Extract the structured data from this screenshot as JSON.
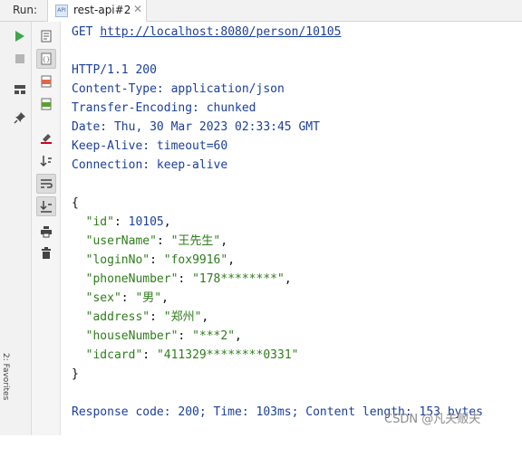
{
  "header": {
    "run_label": "Run:",
    "tab_title": "rest-api#2",
    "tab_icon_text": "API",
    "tab_close": "✕"
  },
  "toolbar_left": [
    {
      "name": "rerun-icon",
      "color": "#3fa64a"
    },
    {
      "name": "stop-icon",
      "color": "#b5b5b5"
    },
    {
      "name": "layout-icon",
      "color": "#4d4d4d"
    },
    {
      "name": "pin-icon",
      "color": "#4d4d4d"
    }
  ],
  "toolbar_secondary": [
    "request-file-icon",
    "json-response-icon",
    "html-response-icon",
    "headers-icon",
    "clear-icon",
    "sort-icon",
    "soft-wrap-icon",
    "scroll-to-end-icon",
    "print-icon",
    "trash-icon"
  ],
  "side_panel_label": "2: Favorites",
  "console": {
    "request_method": "GET",
    "request_url": "http://localhost:8080/person/10105",
    "status_line": "HTTP/1.1 200",
    "headers": [
      "Content-Type: application/json",
      "Transfer-Encoding: chunked",
      "Date: Thu, 30 Mar 2023 02:33:45 GMT",
      "Keep-Alive: timeout=60",
      "Connection: keep-alive"
    ],
    "json_open": "{",
    "json_close": "}",
    "json_fields": [
      {
        "key": "\"id\"",
        "value": "10105",
        "type": "number",
        "comma": ","
      },
      {
        "key": "\"userName\"",
        "value": "\"王先生\"",
        "type": "string",
        "comma": ","
      },
      {
        "key": "\"loginNo\"",
        "value": "\"fox9916\"",
        "type": "string",
        "comma": ","
      },
      {
        "key": "\"phoneNumber\"",
        "value": "\"178********\"",
        "type": "string",
        "comma": ","
      },
      {
        "key": "\"sex\"",
        "value": "\"男\"",
        "type": "string",
        "comma": ","
      },
      {
        "key": "\"address\"",
        "value": "\"郑州\"",
        "type": "string",
        "comma": ","
      },
      {
        "key": "\"houseNumber\"",
        "value": "\"***2\"",
        "type": "string",
        "comma": ","
      },
      {
        "key": "\"idcard\"",
        "value": "\"411329********0331\"",
        "type": "string",
        "comma": ""
      }
    ],
    "summary": "Response code: 200; Time: 103ms; Content length: 153 bytes"
  },
  "watermark": "CSDN @凡夫贩夫",
  "colors": {
    "link": "#1b3f9b",
    "json_key": "#2e7d1b",
    "run_green": "#3fa64a"
  }
}
